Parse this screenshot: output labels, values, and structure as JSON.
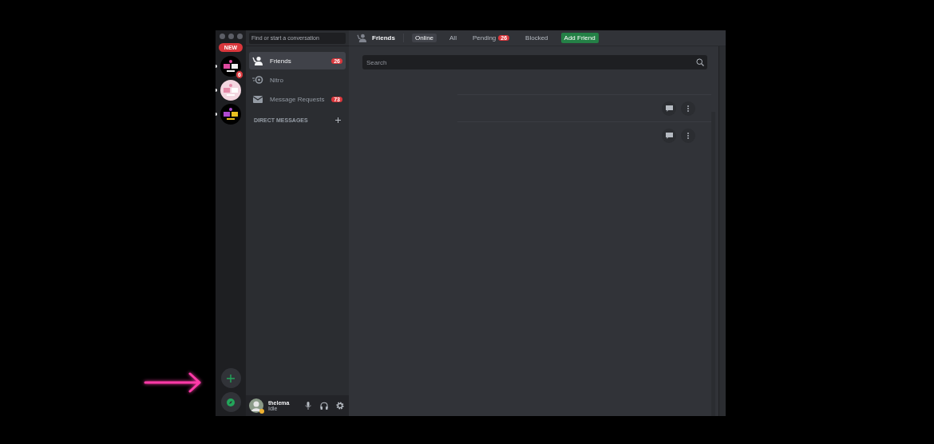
{
  "server_rail": {
    "new_badge": "NEW",
    "servers": [
      {
        "kind": "picture",
        "badge": "6"
      },
      {
        "kind": "picture"
      },
      {
        "kind": "picture"
      }
    ]
  },
  "dm_sidebar": {
    "search": {
      "placeholder": "Find or start a conversation"
    },
    "nav": [
      {
        "kind": "friends",
        "label": "Friends",
        "selected": true,
        "badge": "26"
      },
      {
        "kind": "nitro",
        "label": "Nitro",
        "selected": false
      },
      {
        "kind": "requests",
        "label": "Message Requests",
        "selected": false,
        "badge": "73"
      }
    ],
    "section": "DIRECT MESSAGES"
  },
  "user": {
    "name": "thelema",
    "status": "Idle"
  },
  "header": {
    "title": "Friends",
    "tabs": [
      {
        "label": "Online",
        "selected": true
      },
      {
        "label": "All",
        "selected": false
      },
      {
        "label": "Pending",
        "selected": false,
        "badge": "26"
      },
      {
        "label": "Blocked",
        "selected": false
      }
    ],
    "add_friend": "Add Friend"
  },
  "search": {
    "placeholder": "Search"
  },
  "friend_rows": [
    {
      "kind": "friend"
    },
    {
      "kind": "friend"
    }
  ]
}
